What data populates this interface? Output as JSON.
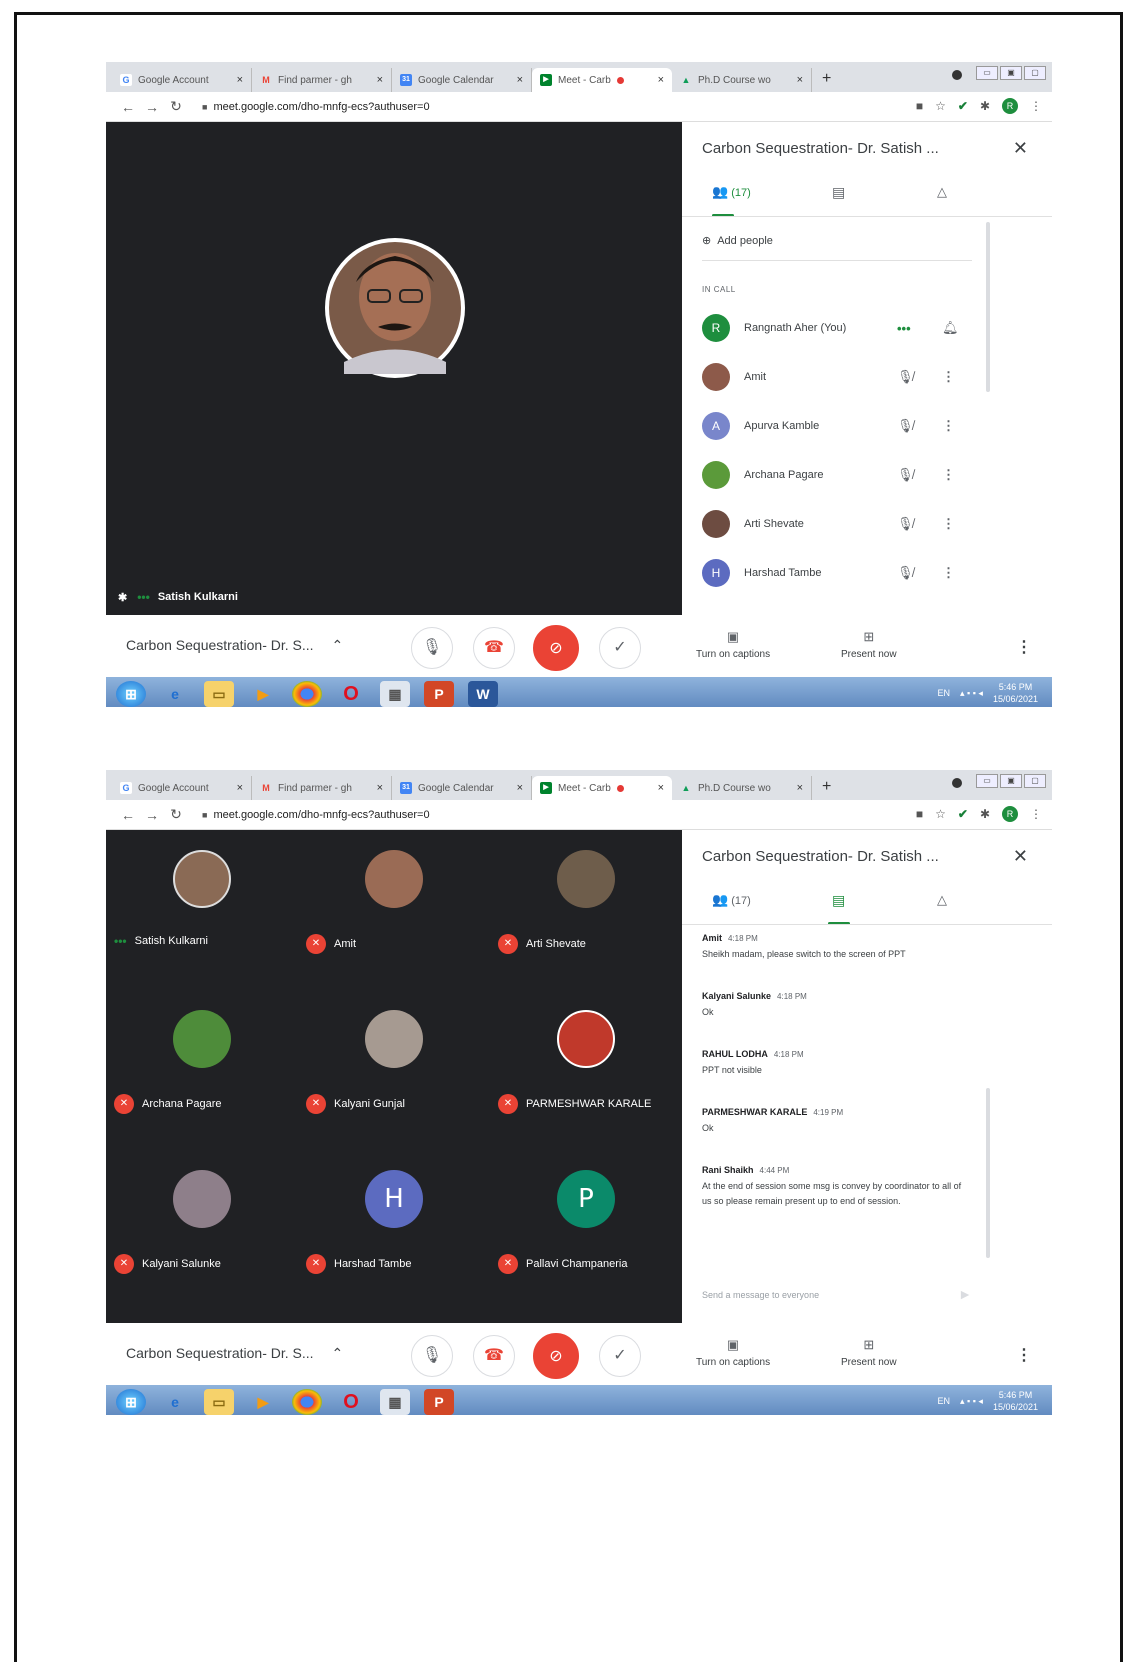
{
  "browser": {
    "tabs": [
      {
        "label": "Google Account",
        "fav": "G",
        "color": "#ffffff"
      },
      {
        "label": "Find parmer - gh",
        "fav": "M",
        "color": "#ea4335"
      },
      {
        "label": "Google Calendar",
        "fav": "31",
        "color": "#4285f4"
      },
      {
        "label": "Meet - Carb",
        "fav": "▶",
        "color": "#00832d"
      },
      {
        "label": "Ph.D Course wo",
        "fav": "▲",
        "color": "#0f9d58"
      }
    ],
    "url": "meet.google.com/dho-mnfg-ecs?authuser=0",
    "profile_initial": "R"
  },
  "meeting": {
    "title": "Carbon Sequestration- Dr. S...",
    "panel_title": "Carbon Sequestration- Dr. Satish ...",
    "people_count": "(17)",
    "captions_label": "Turn on captions",
    "present_label": "Present now"
  },
  "shot1": {
    "presenter_name": "Satish Kulkarni",
    "add_people_label": "Add people",
    "in_call_label": "IN CALL",
    "participants": [
      {
        "name": "Rangnath Aher (You)",
        "initial": "R",
        "color": "#1e8e3e"
      },
      {
        "name": "Amit",
        "initial": "",
        "color": "#8d5a4a"
      },
      {
        "name": "Apurva Kamble",
        "initial": "A",
        "color": "#7986cb"
      },
      {
        "name": "Archana Pagare",
        "initial": "",
        "color": "#5b9a3a"
      },
      {
        "name": "Arti Shevate",
        "initial": "",
        "color": "#6d4c41"
      },
      {
        "name": "Harshad Tambe",
        "initial": "H",
        "color": "#5c6bc0"
      }
    ]
  },
  "shot2": {
    "tiles": [
      {
        "name": "Satish Kulkarni",
        "initial": "",
        "color": "#8a6a55"
      },
      {
        "name": "Amit",
        "initial": "",
        "color": "#9a6b55"
      },
      {
        "name": "Arti Shevate",
        "initial": "",
        "color": "#6e5d4b"
      },
      {
        "name": "Archana Pagare",
        "initial": "",
        "color": "#4e8c3a"
      },
      {
        "name": "Kalyani Gunjal",
        "initial": "",
        "color": "#a69a91"
      },
      {
        "name": "PARMESHWAR KARALE",
        "initial": "",
        "color": "#c0392b"
      },
      {
        "name": "Kalyani Salunke",
        "initial": "",
        "color": "#8e7f8a"
      },
      {
        "name": "Harshad Tambe",
        "initial": "H",
        "color": "#5c6bc0"
      },
      {
        "name": "Pallavi Champaneria",
        "initial": "P",
        "color": "#0b8a6a"
      }
    ],
    "messages": [
      {
        "sender": "Amit",
        "time": "4:18 PM",
        "text": "Sheikh madam, please switch to the screen of PPT"
      },
      {
        "sender": "Kalyani Salunke",
        "time": "4:18 PM",
        "text": "Ok"
      },
      {
        "sender": "RAHUL LODHA",
        "time": "4:18 PM",
        "text": "PPT not visible"
      },
      {
        "sender": "PARMESHWAR KARALE",
        "time": "4:19 PM",
        "text": "Ok"
      },
      {
        "sender": "Rani Shaikh",
        "time": "4:44 PM",
        "text": "At the end of session some msg is convey by coordinator to all of us so please remain present up to end of session."
      }
    ],
    "send_placeholder": "Send a message to everyone"
  },
  "taskbar": {
    "time": "5:46 PM",
    "date": "15/06/2021",
    "lang": "EN"
  }
}
